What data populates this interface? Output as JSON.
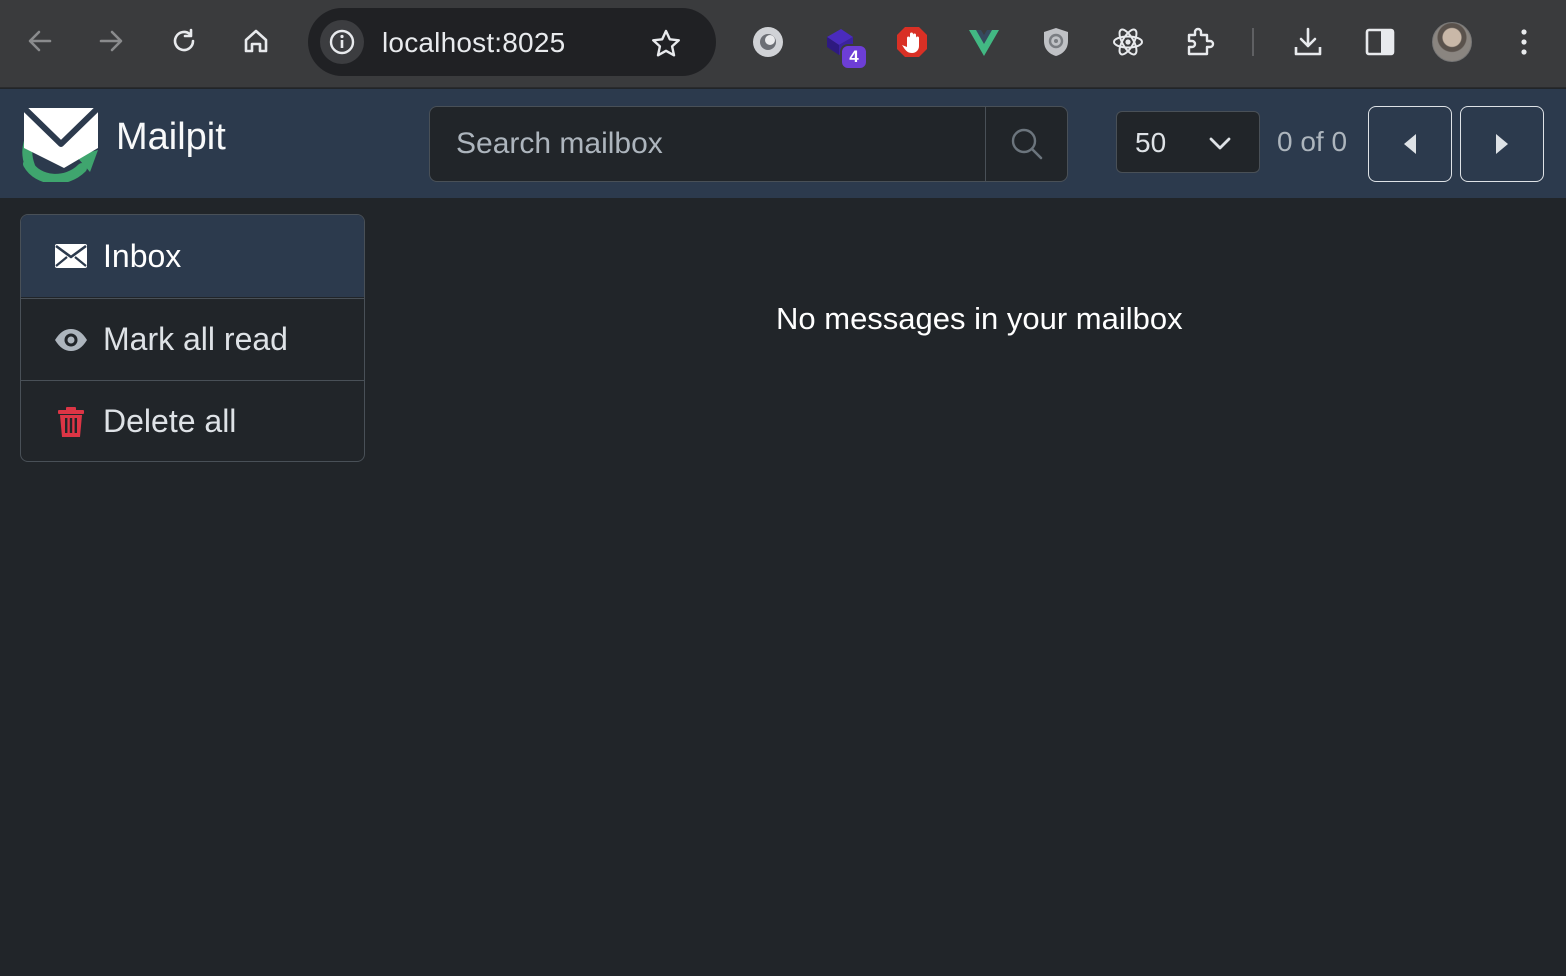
{
  "browser": {
    "url": "localhost:8025",
    "extension_badge": "4"
  },
  "app": {
    "brand": "Mailpit",
    "search_placeholder": "Search mailbox",
    "per_page": "50",
    "count_text": "0 of 0",
    "accent_color": "#2c3a4d"
  },
  "sidebar": {
    "items": [
      {
        "label": "Inbox",
        "icon": "envelope-icon"
      },
      {
        "label": "Mark all read",
        "icon": "eye-icon"
      },
      {
        "label": "Delete all",
        "icon": "trash-icon"
      }
    ]
  },
  "main": {
    "empty_message": "No messages in your mailbox"
  }
}
